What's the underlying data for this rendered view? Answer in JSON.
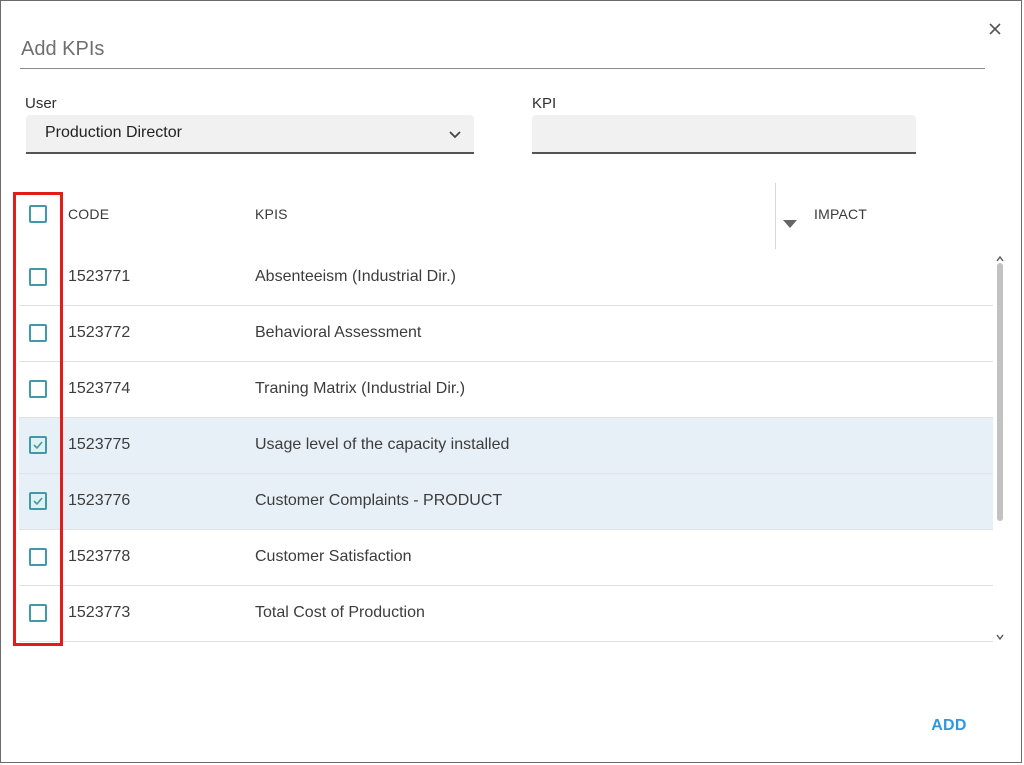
{
  "dialog": {
    "title": "Add KPIs",
    "close_icon": "close-icon"
  },
  "filters": {
    "user_label": "User",
    "user_value": "Production Director",
    "kpi_label": "KPI",
    "kpi_value": "",
    "kpi_placeholder": ""
  },
  "table": {
    "columns": {
      "code": "CODE",
      "kpis": "KPIS",
      "impact": "IMPACT"
    },
    "header_checkbox_checked": false,
    "rows": [
      {
        "code": "1523771",
        "kpi": "Absenteeism (Industrial Dir.)",
        "checked": false
      },
      {
        "code": "1523772",
        "kpi": "Behavioral Assessment",
        "checked": false
      },
      {
        "code": "1523774",
        "kpi": "Traning Matrix (Industrial Dir.)",
        "checked": false
      },
      {
        "code": "1523775",
        "kpi": "Usage level of the capacity installed",
        "checked": true
      },
      {
        "code": "1523776",
        "kpi": "Customer Complaints - PRODUCT",
        "checked": true
      },
      {
        "code": "1523778",
        "kpi": "Customer Satisfaction",
        "checked": false
      },
      {
        "code": "1523773",
        "kpi": "Total Cost of Production",
        "checked": false
      }
    ]
  },
  "actions": {
    "add_label": "ADD"
  },
  "colors": {
    "checkbox_border": "#3e9aa7",
    "selected_row_bg": "#e8f0f7",
    "add_button": "#2f98e0",
    "highlight": "#e21b1b"
  }
}
